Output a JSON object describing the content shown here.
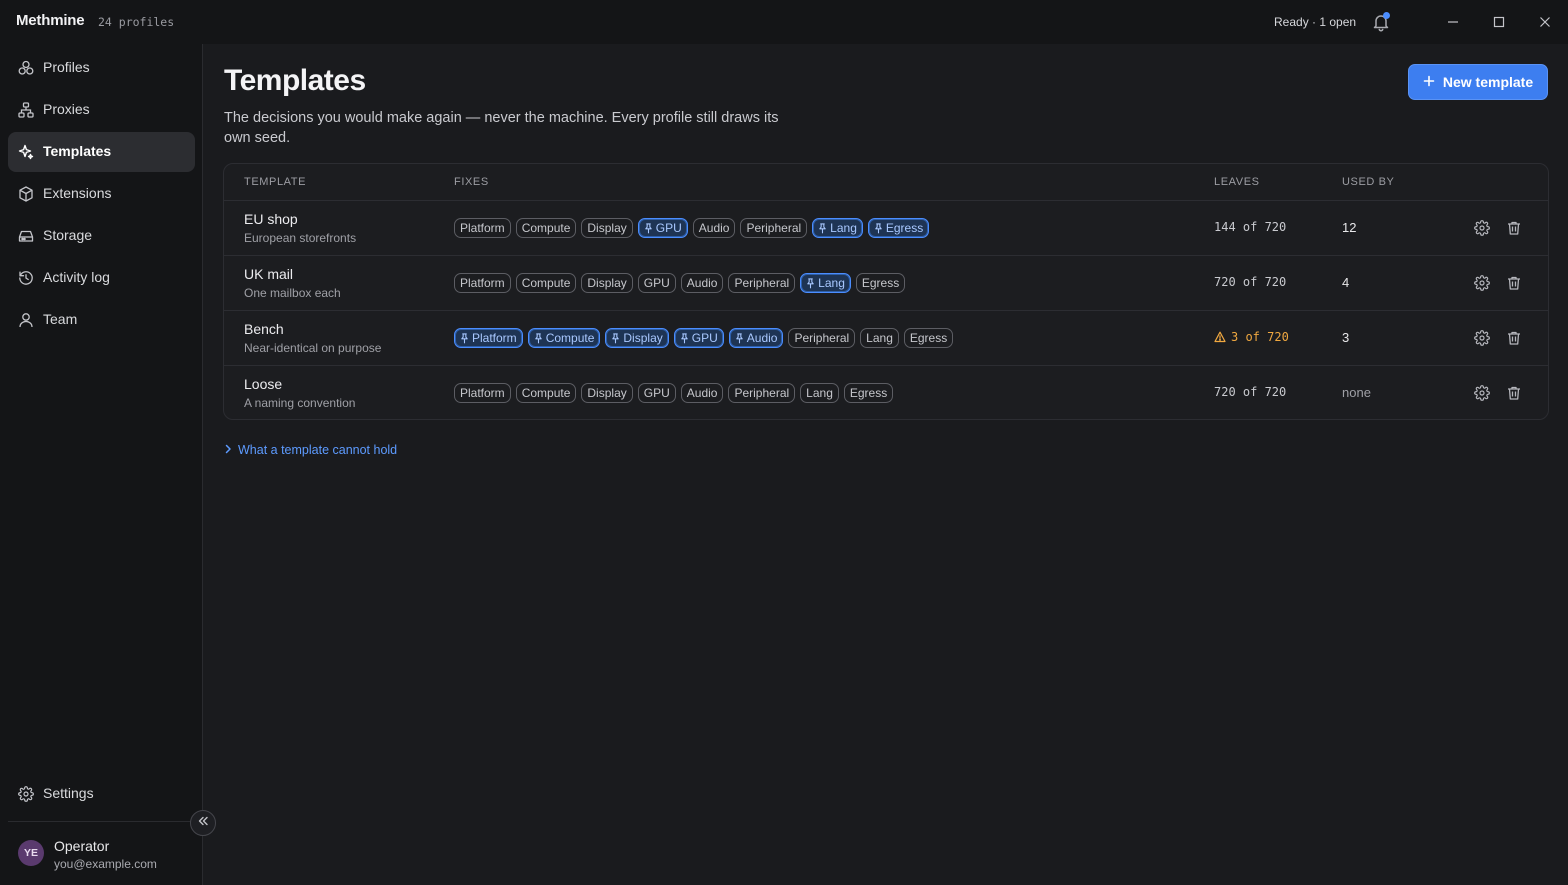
{
  "app": {
    "name": "Methmine",
    "profile_count": "24 profiles",
    "status": "Ready · 1 open"
  },
  "sidebar": {
    "items": [
      {
        "label": "Profiles",
        "icon": "profiles-icon"
      },
      {
        "label": "Proxies",
        "icon": "proxies-icon"
      },
      {
        "label": "Templates",
        "icon": "templates-icon",
        "active": true
      },
      {
        "label": "Extensions",
        "icon": "extensions-icon"
      },
      {
        "label": "Storage",
        "icon": "storage-icon"
      },
      {
        "label": "Activity log",
        "icon": "activity-log-icon"
      },
      {
        "label": "Team",
        "icon": "team-icon"
      }
    ],
    "settings_label": "Settings",
    "user": {
      "initials": "YE",
      "name": "Operator",
      "email": "you@example.com"
    }
  },
  "main": {
    "title": "Templates",
    "subtitle": "The decisions you would make again — never the machine. Every profile still draws its own seed.",
    "new_button": "New template",
    "columns": {
      "template": "TEMPLATE",
      "fixes": "FIXES",
      "leaves": "LEAVES",
      "used_by": "USED BY"
    },
    "rows": [
      {
        "name": "EU shop",
        "desc": "European storefronts",
        "fixes": [
          {
            "label": "Platform",
            "pinned": false
          },
          {
            "label": "Compute",
            "pinned": false
          },
          {
            "label": "Display",
            "pinned": false
          },
          {
            "label": "GPU",
            "pinned": true
          },
          {
            "label": "Audio",
            "pinned": false
          },
          {
            "label": "Peripheral",
            "pinned": false
          },
          {
            "label": "Lang",
            "pinned": true
          },
          {
            "label": "Egress",
            "pinned": true
          }
        ],
        "leaves": "144 of 720",
        "warn": false,
        "used_by": "12"
      },
      {
        "name": "UK mail",
        "desc": "One mailbox each",
        "fixes": [
          {
            "label": "Platform",
            "pinned": false
          },
          {
            "label": "Compute",
            "pinned": false
          },
          {
            "label": "Display",
            "pinned": false
          },
          {
            "label": "GPU",
            "pinned": false
          },
          {
            "label": "Audio",
            "pinned": false
          },
          {
            "label": "Peripheral",
            "pinned": false
          },
          {
            "label": "Lang",
            "pinned": true
          },
          {
            "label": "Egress",
            "pinned": false
          }
        ],
        "leaves": "720 of 720",
        "warn": false,
        "used_by": "4"
      },
      {
        "name": "Bench",
        "desc": "Near-identical on purpose",
        "fixes": [
          {
            "label": "Platform",
            "pinned": true
          },
          {
            "label": "Compute",
            "pinned": true
          },
          {
            "label": "Display",
            "pinned": true
          },
          {
            "label": "GPU",
            "pinned": true
          },
          {
            "label": "Audio",
            "pinned": true
          },
          {
            "label": "Peripheral",
            "pinned": false
          },
          {
            "label": "Lang",
            "pinned": false
          },
          {
            "label": "Egress",
            "pinned": false
          }
        ],
        "leaves": "3 of 720",
        "warn": true,
        "used_by": "3"
      },
      {
        "name": "Loose",
        "desc": "A naming convention",
        "fixes": [
          {
            "label": "Platform",
            "pinned": false
          },
          {
            "label": "Compute",
            "pinned": false
          },
          {
            "label": "Display",
            "pinned": false
          },
          {
            "label": "GPU",
            "pinned": false
          },
          {
            "label": "Audio",
            "pinned": false
          },
          {
            "label": "Peripheral",
            "pinned": false
          },
          {
            "label": "Lang",
            "pinned": false
          },
          {
            "label": "Egress",
            "pinned": false
          }
        ],
        "leaves": "720 of 720",
        "warn": false,
        "used_by": "none"
      }
    ],
    "disclosure": "What a template cannot hold"
  },
  "colors": {
    "accent": "#3d7ef0",
    "pinned_border": "#4b8dff",
    "warning": "#f0a840",
    "background": "#1a1b1e",
    "sidebar": "#141517"
  }
}
